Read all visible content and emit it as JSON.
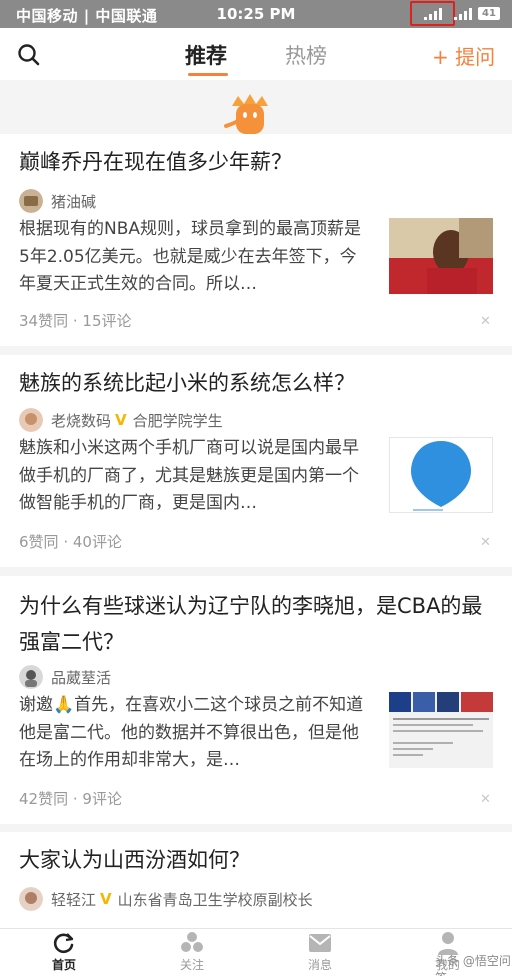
{
  "status_bar": {
    "carrier": "中国移动 | 中国联通",
    "time": "10:25 PM",
    "battery": "41"
  },
  "header": {
    "tab_recommend": "推荐",
    "tab_hot": "热榜",
    "ask_label": "+ 提问"
  },
  "accent_color": "#f6813b",
  "cards": [
    {
      "title": "巅峰乔丹在现在值多少年薪？",
      "author": "猪油碱",
      "excerpt": "根据现有的NBA规则，球员拿到的最高顶薪是5年2.05亿美元。也就是威少在去年签下，今年夏天正式生效的合同。所以…",
      "likes": "34赞同",
      "comments": "15评论"
    },
    {
      "title": "魅族的系统比起小米的系统怎么样？",
      "author": "老烧数码",
      "author_desc": "合肥学院学生",
      "excerpt": "魅族和小米这两个手机厂商可以说是国内最早做手机的厂商了，尤其是魅族更是国内第一个做智能手机的厂商，更是国内…",
      "likes": "6赞同",
      "comments": "40评论"
    },
    {
      "title": "为什么有些球迷认为辽宁队的李晓旭，是CBA的最强富二代？",
      "author": "品葳荎活",
      "excerpt": "谢邀🙏首先，在喜欢小二这个球员之前不知道他是富二代。他的数据并不算很出色，但是他在场上的作用却非常大，是…",
      "likes": "42赞同",
      "comments": "9评论"
    },
    {
      "title": "大家认为山西汾酒如何？",
      "author": "轻轻江",
      "author_desc": "山东省青岛卫生学校原副校长"
    }
  ],
  "bottom_nav": {
    "home": "首页",
    "follow": "关注",
    "messages": "消息",
    "me": "我的"
  },
  "watermark": "头条 @悟空问答"
}
